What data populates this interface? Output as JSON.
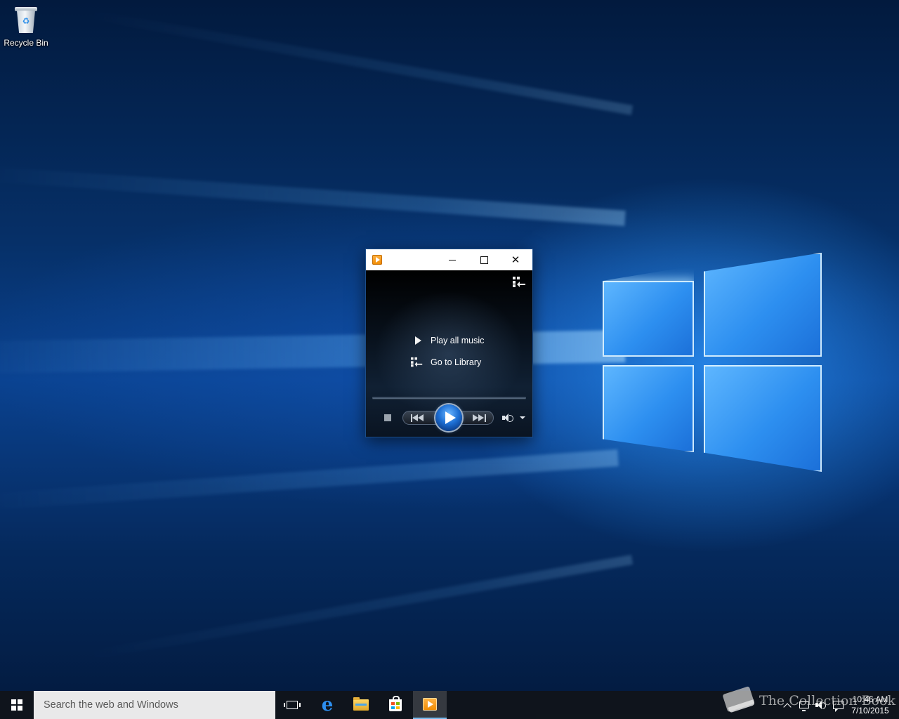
{
  "desktop": {
    "icons": [
      {
        "label": "Recycle Bin",
        "icon": "recycle-bin-icon"
      }
    ]
  },
  "media_player": {
    "app_icon": "windows-media-player-icon",
    "caption": {
      "minimize": "minimize-icon",
      "maximize": "maximize-icon",
      "close": "close-icon",
      "close_glyph": "✕"
    },
    "menu": {
      "play_all": "Play all music",
      "go_library": "Go to Library"
    },
    "controls": {
      "stop": "stop-icon",
      "previous": "previous-track-icon",
      "play": "play-icon",
      "next": "next-track-icon",
      "volume": "speaker-icon"
    }
  },
  "taskbar": {
    "search_placeholder": "Search the web and Windows",
    "pinned": [
      "task-view-icon",
      "edge-icon",
      "file-explorer-icon",
      "store-icon",
      "windows-media-player-icon"
    ],
    "tray": {
      "time": "10:46 AM",
      "date": "7/10/2015"
    },
    "edge_glyph": "e"
  },
  "watermark": {
    "text": "The Collection Book"
  },
  "colors": {
    "accent": "#76b9ed",
    "wallpaper_dark": "#031c42",
    "wallpaper_light": "#5fb7ff",
    "wmp_orange": "#f08a00"
  }
}
